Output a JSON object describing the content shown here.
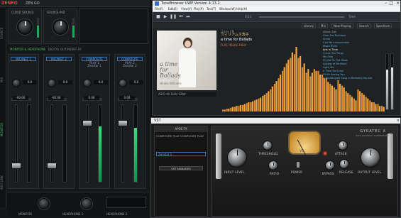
{
  "mixer": {
    "logo": "ZENEO",
    "app_name": "ZEN GO",
    "side_tabs": [
      "SOURCE",
      "MIX",
      "MONITOR",
      "ASIO LINK"
    ],
    "src_labels": [
      "CLOUD SOURCE",
      "SOURCE PAD"
    ],
    "section_tabs": [
      "MONITOR & HEADPHONE",
      "DIGITAL OUT",
      "INSERT FX"
    ],
    "strips": [
      {
        "name": "MIC/INST 1",
        "sub": "",
        "gain": "0.0",
        "level": "-60.00",
        "meter": 0.0,
        "fader": 0.18
      },
      {
        "name": "MIC/INST 2",
        "sub": "",
        "gain": "0.0",
        "level": "-60.00",
        "meter": 0.0,
        "fader": 0.18
      },
      {
        "name": "COMPOSITE PLAY 1",
        "sub": "Zenstar 1",
        "gain": "0.0",
        "level": "0.00",
        "meter": 0.72,
        "fader": 0.78
      },
      {
        "name": "COMPOSITE PLAY 2",
        "sub": "Zenstar 2",
        "gain": "0.0",
        "level": "0.00",
        "meter": 0.7,
        "fader": 0.78
      }
    ],
    "bottom": {
      "monitor": "MONITOR",
      "headphone": "HEADPHONE 1",
      "headphone2": "HEADPHONE 2"
    }
  },
  "player": {
    "title": "TuneBrowser UWP Version 4.13.2",
    "menu": [
      "File(F)",
      "Edit(E)",
      "View(V)",
      "Play(P)",
      "Tool(T)",
      "Window(W)",
      "Help(H)"
    ],
    "time_left": "0:23",
    "time_right": "Time",
    "tabs": [
      "Library",
      "Mix",
      "Now Playing",
      "Search",
      "Spectrum"
    ],
    "status": "Listen FM",
    "np": "ASIO 44.1kHz 32bit",
    "track": {
      "artist": "ウィリアムス浩子",
      "album": "a time for Ballads",
      "format": "FLAC 96kHz 24bit"
    },
    "cover": {
      "title_line1": "a time",
      "title_line2": "for",
      "title_line3": "Ballads",
      "artist": "Hiroko Williams"
    },
    "playlist": [
      "Over the Rainbow",
      "Smile",
      "Call Me Irresponsible",
      "Moon River",
      "Just in Time",
      "I Love You Porgy",
      "My Ship",
      "Fly Me To The Moon",
      "Lullaby of Birdland",
      "Light Me",
      "A Time For Love",
      "I'll Be Seeing You",
      "A Nightingale Sang in Berkeley Square"
    ],
    "playlist_header": "Album List",
    "spectrum_left": [
      2,
      3,
      4,
      5,
      6,
      7,
      9,
      10,
      12,
      14,
      17,
      20,
      24,
      30,
      36,
      44,
      52,
      58,
      62,
      58,
      48,
      42,
      38,
      46,
      44,
      40,
      36,
      30,
      26,
      34,
      28,
      22,
      18,
      14,
      24,
      20,
      16,
      12,
      10,
      8,
      6
    ],
    "spectrum_right": [
      2,
      3,
      5,
      6,
      7,
      8,
      10,
      11,
      13,
      15,
      18,
      22,
      27,
      33,
      40,
      48,
      56,
      64,
      70,
      60,
      52,
      46,
      42,
      44,
      40,
      36,
      32,
      28,
      24,
      30,
      26,
      20,
      16,
      12,
      22,
      18,
      14,
      10,
      8,
      6,
      5
    ]
  },
  "plugin": {
    "title": "VST",
    "preset_header": "APOS FX",
    "preset_cols": [
      "COMPOSITE PLAY",
      "COMPOSITE PLAY"
    ],
    "preset_value": "Zenstar 1",
    "preset_button": "VST MANAGER",
    "brand": "GYRATEC X",
    "sublabel": "HIGH ACCURACY COMPRESSOR",
    "vu_text": "VU",
    "labels": {
      "input": "INPUT LEVEL",
      "threshold": "THRESHOLD",
      "ratio": "RATIO",
      "attack": "ATTACK",
      "release": "RELEASE",
      "output": "OUTPUT LEVEL",
      "power": "POWER",
      "bypass": "BYPASS"
    }
  }
}
